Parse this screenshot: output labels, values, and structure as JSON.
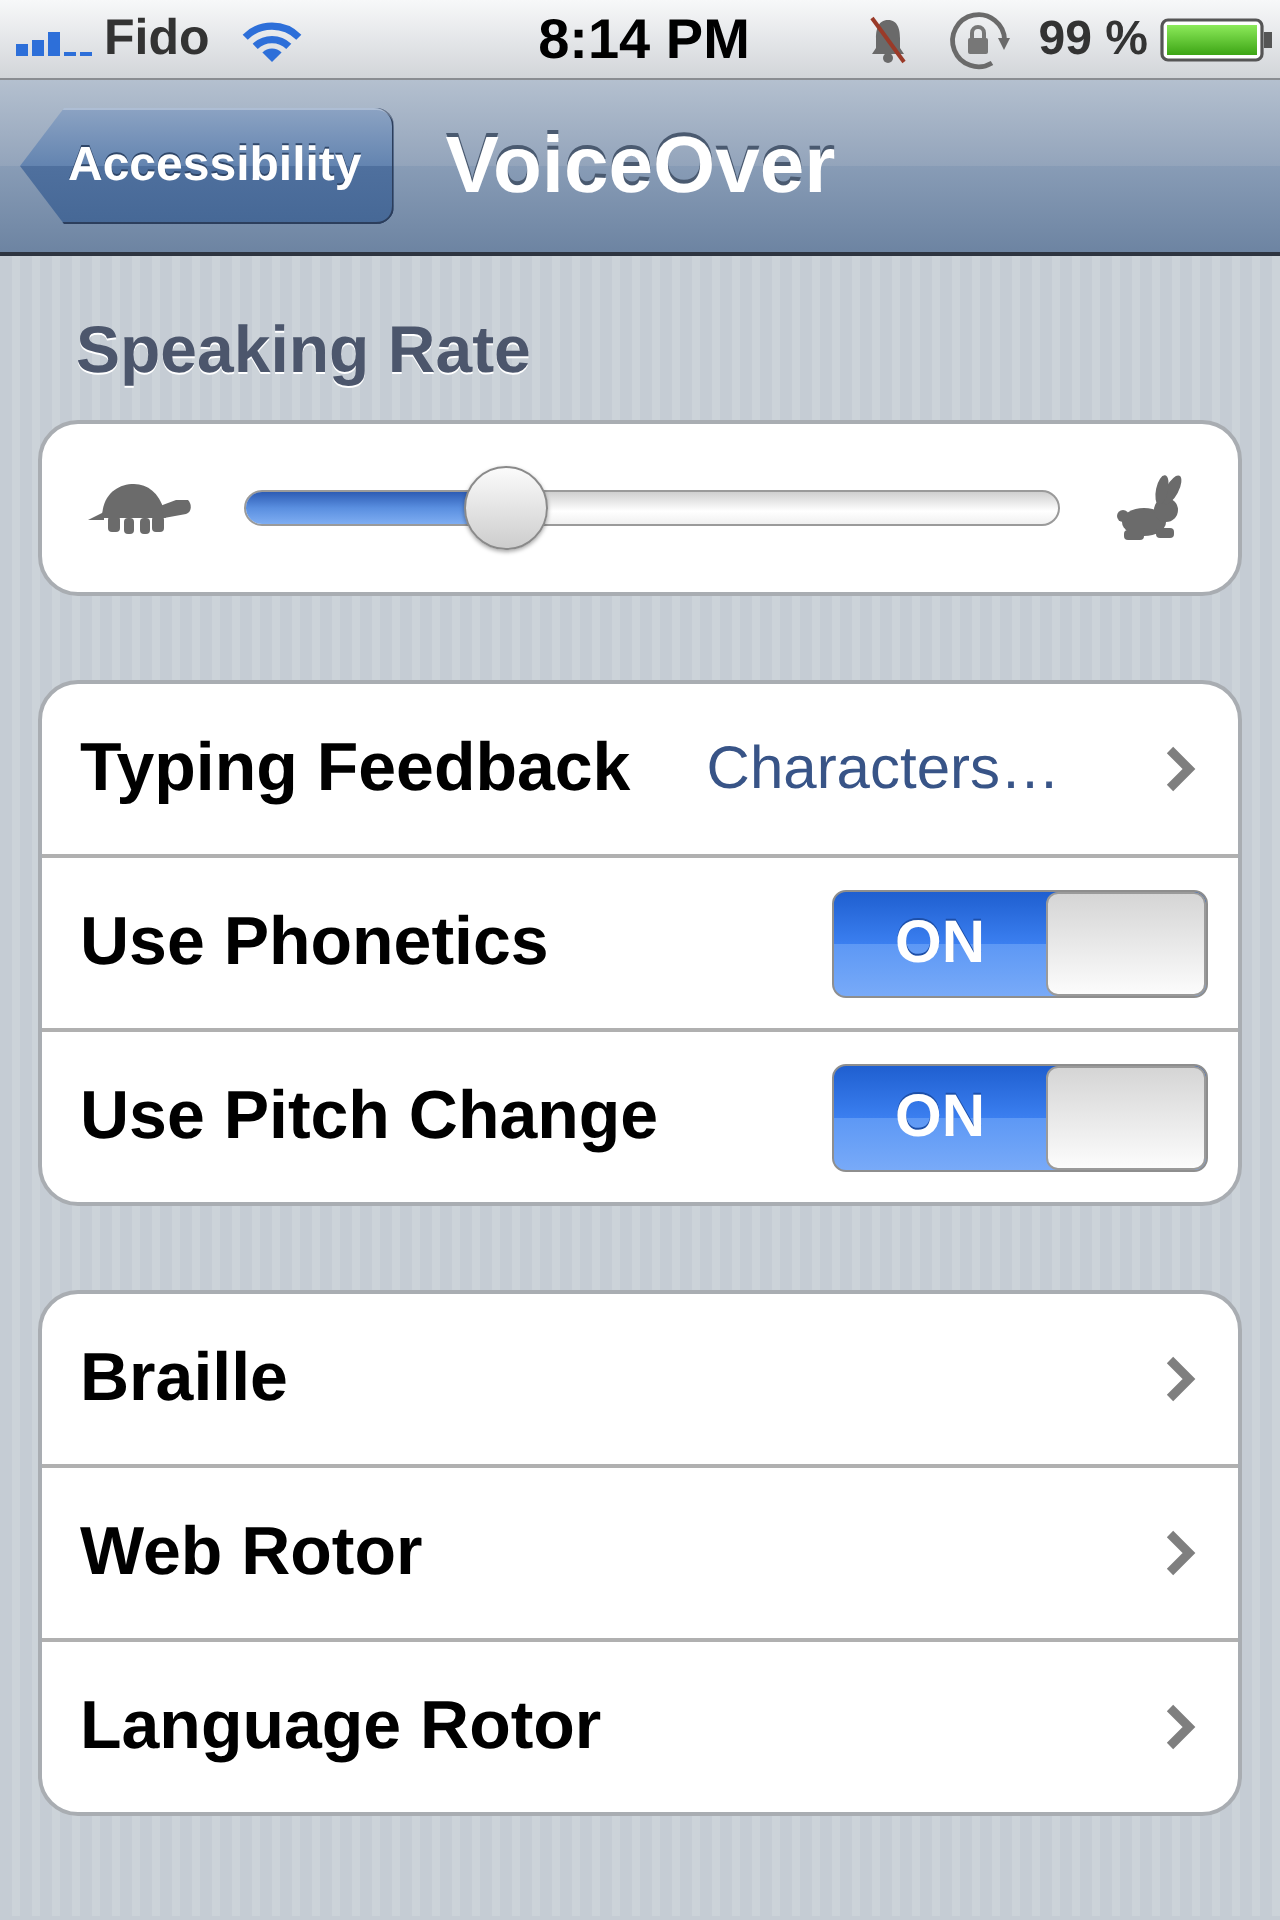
{
  "status_bar": {
    "carrier": "Fido",
    "time": "8:14 PM",
    "battery": "99 %"
  },
  "nav_bar": {
    "back_button": "Accessibility",
    "title": "VoiceOver"
  },
  "speaking_rate": {
    "header": "Speaking Rate",
    "level": 0.3
  },
  "groups": [
    {
      "rows": [
        {
          "kind": "value",
          "label": "Typing Feedback",
          "value": "Characters…"
        },
        {
          "kind": "switch",
          "label": "Use Phonetics",
          "on": true,
          "switch_text": "ON"
        },
        {
          "kind": "switch",
          "label": "Use Pitch Change",
          "on": true,
          "switch_text": "ON"
        }
      ]
    },
    {
      "rows": [
        {
          "kind": "link",
          "label": "Braille"
        },
        {
          "kind": "link",
          "label": "Web Rotor"
        },
        {
          "kind": "link",
          "label": "Language Rotor"
        }
      ]
    }
  ]
}
